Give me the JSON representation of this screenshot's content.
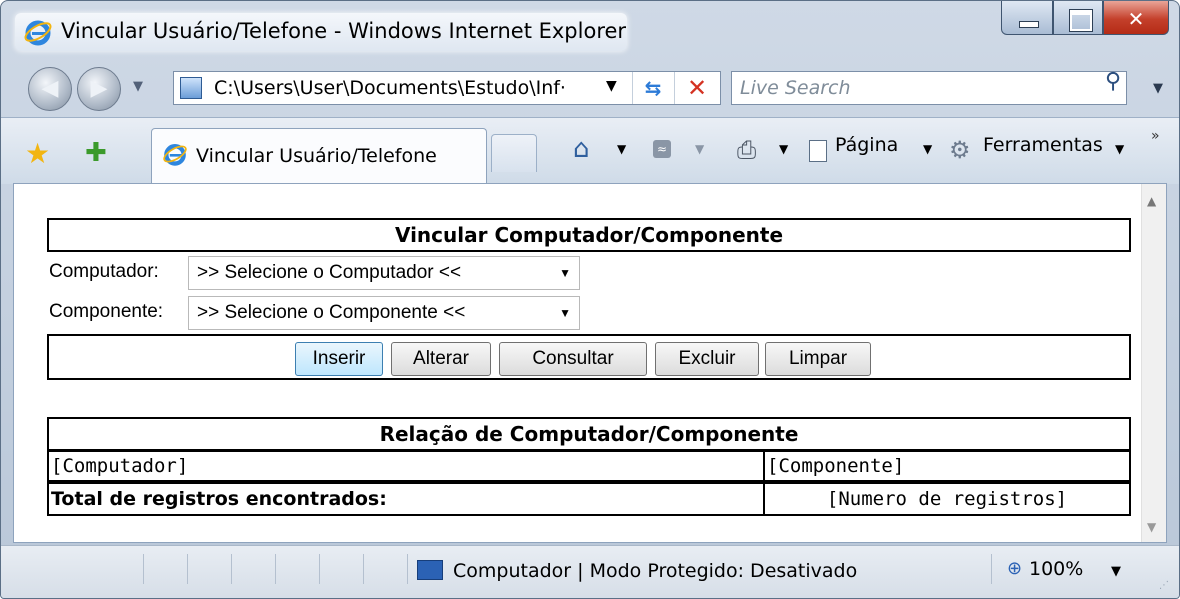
{
  "window": {
    "title": "Vincular Usuário/Telefone - Windows Internet Explorer"
  },
  "address_bar": {
    "url": "C:\\Users\\User\\Documents\\Estudo\\Inf‧",
    "search_placeholder": "Live Search"
  },
  "tab": {
    "label": "Vincular Usuário/Telefone"
  },
  "commands": {
    "page": "Página",
    "tools": "Ferramentas"
  },
  "form": {
    "title": "Vincular Computador/Componente",
    "computador_label": "Computador:",
    "computador_value": ">> Selecione o Computador <<",
    "componente_label": "Componente:",
    "componente_value": ">> Selecione o Componente <<",
    "buttons": {
      "inserir": "Inserir",
      "alterar": "Alterar",
      "consultar": "Consultar",
      "excluir": "Excluir",
      "limpar": "Limpar"
    }
  },
  "report": {
    "title": "Relação de Computador/Componente",
    "col_computador": "[Computador]",
    "col_componente": "[Componente]",
    "total_label": "Total de registros encontrados:",
    "total_value": "[Numero de registros]"
  },
  "status_bar": {
    "zone": "Computador | Modo Protegido: Desativado",
    "zoom": "100%"
  },
  "colors": {
    "close_button": "#c4402b",
    "ie_blue": "#2d7bd7",
    "focused_button": "#bee6fd"
  }
}
